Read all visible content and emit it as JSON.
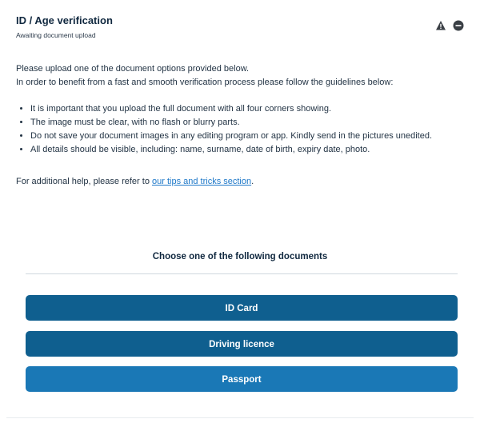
{
  "header": {
    "title": "ID / Age verification",
    "subtitle": "Awaiting document upload",
    "icons": [
      "warning-icon",
      "minus-circle-icon"
    ]
  },
  "instructions": {
    "line1": "Please upload one of the document options provided below.",
    "line2": "In order to benefit from a fast and smooth verification process please follow the guidelines below:",
    "guidelines": [
      "It is important that you upload the full document with all four corners showing.",
      "The image must be clear, with no flash or blurry parts.",
      "Do not save your document images in any editing program or app. Kindly send in the pictures unedited.",
      "All details should be visible, including: name, surname, date of birth, expiry date, photo."
    ],
    "help_prefix": "For additional help, please refer to ",
    "help_link": "our tips and tricks section",
    "help_suffix": "."
  },
  "documents": {
    "heading": "Choose one of the following documents",
    "options": [
      "ID Card",
      "Driving licence",
      "Passport"
    ]
  },
  "colors": {
    "primary_button": "#0f5f8f",
    "passport_button": "#1a78b6",
    "link": "#1e78c8",
    "title": "#10283f"
  }
}
